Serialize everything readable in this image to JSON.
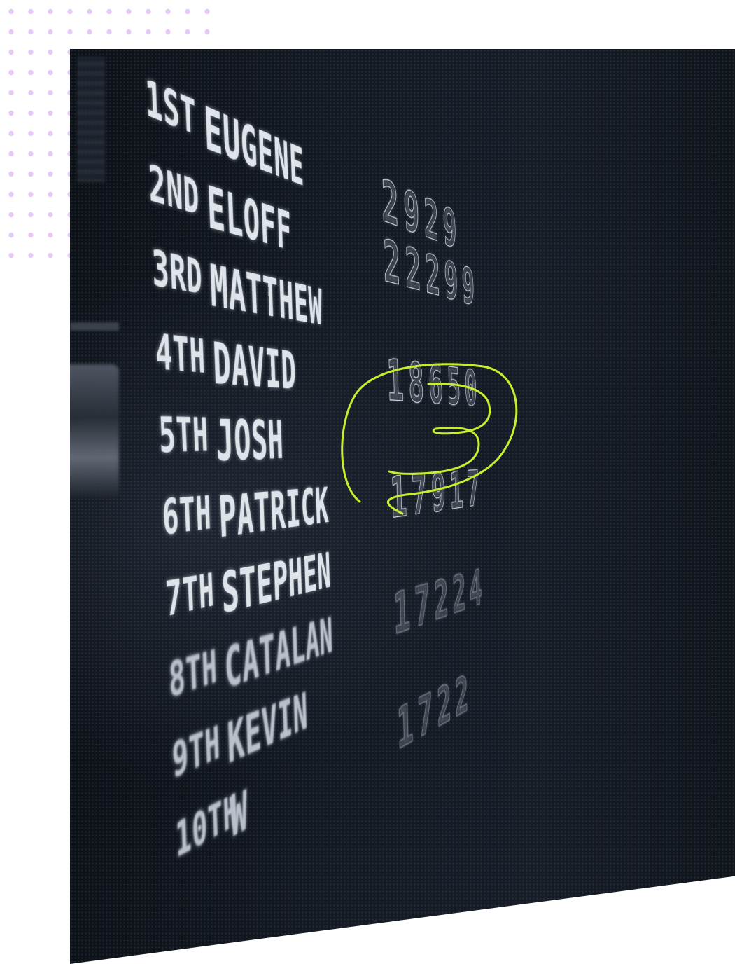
{
  "decoration": {
    "dot_color": "#e6c9f6",
    "annotation_color": "#c6ef2d",
    "annotation_label": "3"
  },
  "scoreboard": {
    "rows": [
      {
        "rank": "1ST",
        "name": "EUGENE",
        "score": "2929"
      },
      {
        "rank": "2ND",
        "name": "ELOFF",
        "score": "22299"
      },
      {
        "rank": "3RD",
        "name": "MATTHEW",
        "score": ""
      },
      {
        "rank": "4TH",
        "name": "DAVID",
        "score": "18650"
      },
      {
        "rank": "5TH",
        "name": "JOSH",
        "score": ""
      },
      {
        "rank": "6TH",
        "name": "PATRICK",
        "score": "17917"
      },
      {
        "rank": "7TH",
        "name": "STEPHEN",
        "score": ""
      },
      {
        "rank": "8TH",
        "name": "CATALAN",
        "score": "17224"
      },
      {
        "rank": "9TH",
        "name": "KEVIN",
        "score": ""
      },
      {
        "rank": "10TH",
        "name": "W",
        "score": "1722"
      }
    ]
  }
}
